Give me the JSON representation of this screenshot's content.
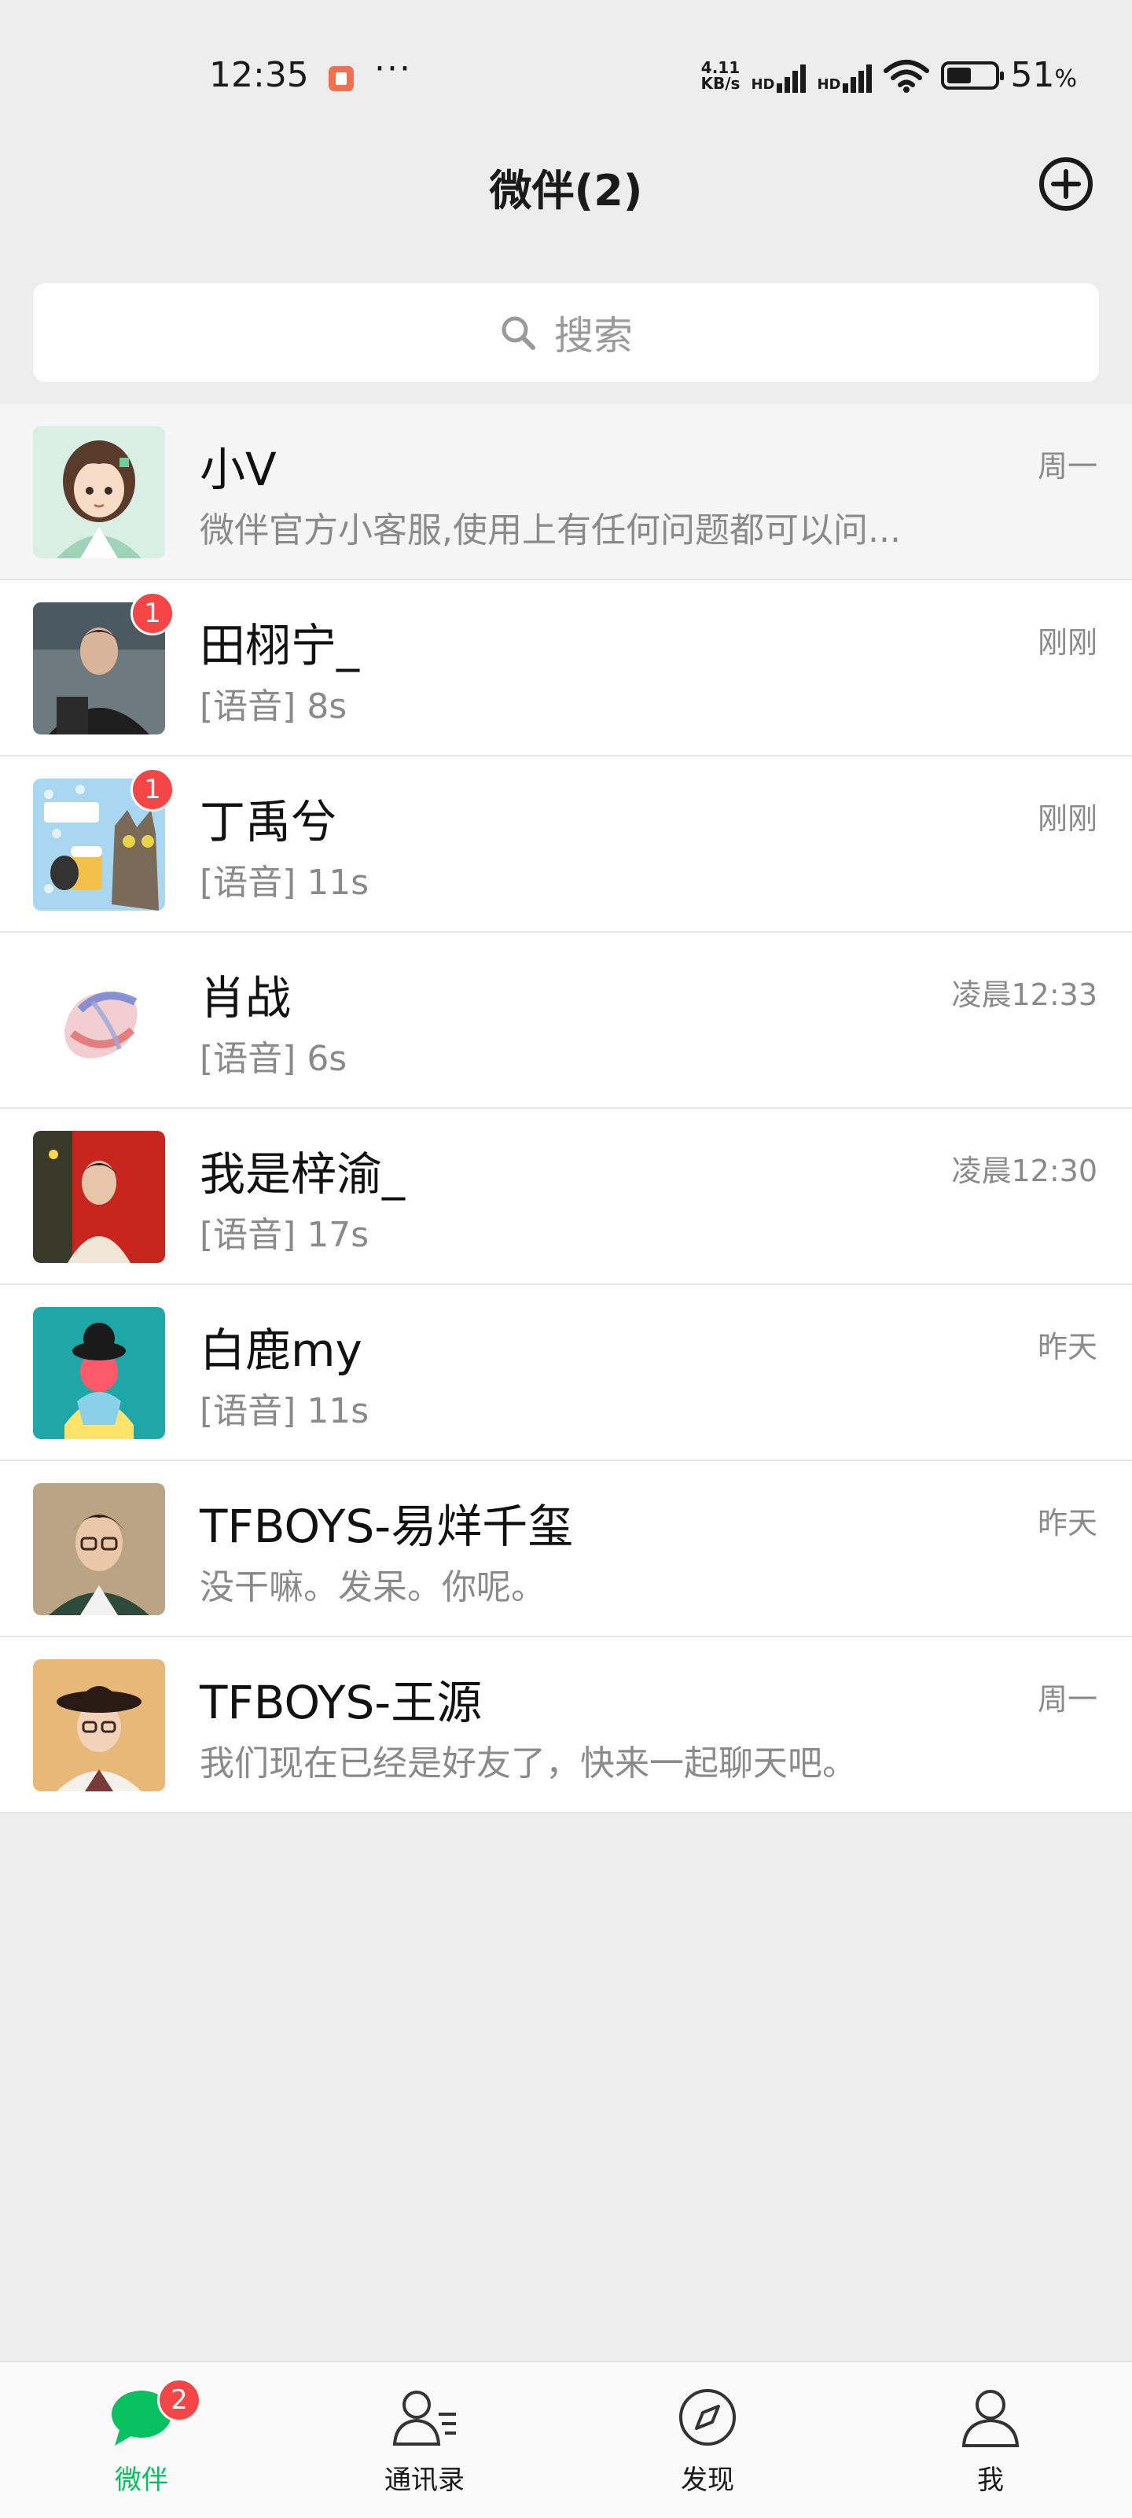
{
  "status_bar": {
    "time": "12:35",
    "dots": "···",
    "net_speed_top": "4.11",
    "net_speed_bottom": "KB/s",
    "sig1_label": "HD",
    "sig2_label": "HD",
    "battery_percent": "51",
    "battery_unit": "%"
  },
  "header": {
    "title": "微伴(2)"
  },
  "search": {
    "placeholder": "搜索"
  },
  "chats": [
    {
      "name": "小V",
      "preview": "微伴官方小客服,使用上有任何问题都可以问...",
      "time": "周一",
      "badge": ""
    },
    {
      "name": "田栩宁_",
      "preview": "[语音] 8s",
      "time": "刚刚",
      "badge": "1"
    },
    {
      "name": "丁禹兮",
      "preview": "[语音] 11s",
      "time": "刚刚",
      "badge": "1"
    },
    {
      "name": "肖战",
      "preview": "[语音] 6s",
      "time": "凌晨12:33",
      "badge": ""
    },
    {
      "name": "我是梓渝_",
      "preview": "[语音] 17s",
      "time": "凌晨12:30",
      "badge": ""
    },
    {
      "name": "白鹿my",
      "preview": "[语音] 11s",
      "time": "昨天",
      "badge": ""
    },
    {
      "name": "TFBOYS-易烊千玺",
      "preview": "没干嘛。发呆。你呢。",
      "time": "昨天",
      "badge": ""
    },
    {
      "name": "TFBOYS-王源",
      "preview": "我们现在已经是好友了，快来一起聊天吧。",
      "time": "周一",
      "badge": ""
    }
  ],
  "tabs": [
    {
      "label": "微伴",
      "badge": "2",
      "icon": "chat-bubble-icon"
    },
    {
      "label": "通讯录",
      "icon": "contacts-icon"
    },
    {
      "label": "发现",
      "icon": "compass-icon"
    },
    {
      "label": "我",
      "icon": "person-icon"
    }
  ],
  "colors": {
    "accent": "#07c160",
    "badge": "#f44646",
    "background": "#ededed"
  }
}
